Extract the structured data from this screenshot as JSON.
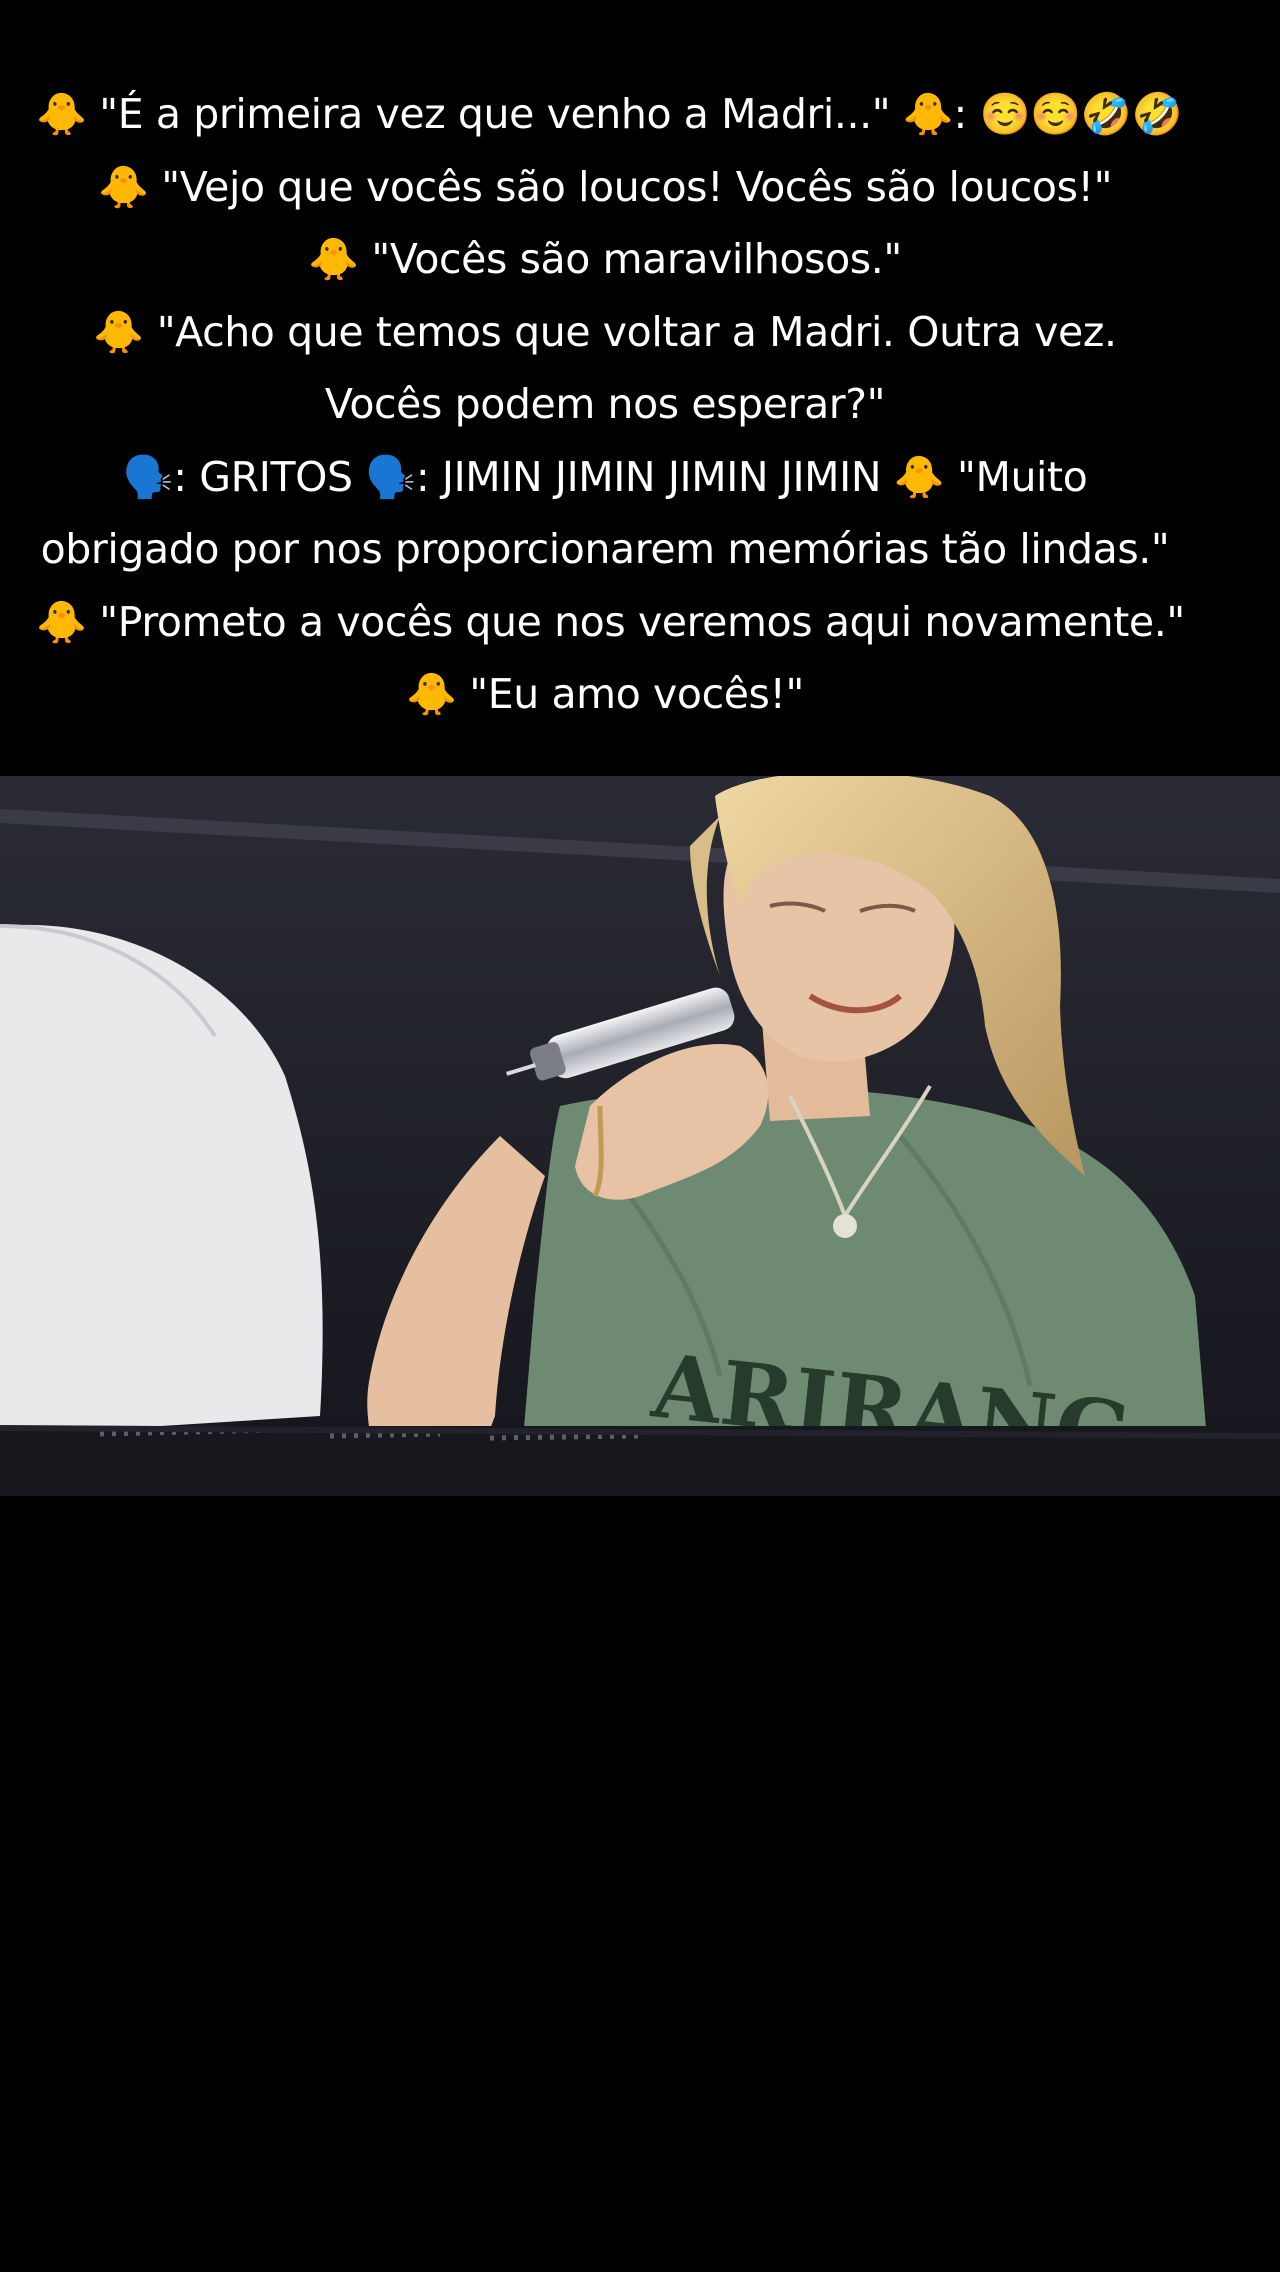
{
  "caption": {
    "lines": [
      "🐥 \"É a primeira vez que venho a Madri...\" 🐥: ☺️☺️🤣🤣",
      "🐥 \"Vejo que vocês são loucos! Vocês são loucos!\"",
      "🐥 \"Vocês são maravilhosos.\"",
      "🐥 \"Acho que temos que voltar a Madri. Outra vez. Vocês podem nos esperar?\"",
      "🗣️: GRITOS 🗣️: JIMIN JIMIN JIMIN JIMIN 🐥 \"Muito obrigado por nos proporcionarem memórias tão lindas.\"",
      "🐥 \"Prometo a vocês que nos veremos aqui novamente.\"",
      "🐥 \"Eu amo vocês!\""
    ]
  },
  "video": {
    "shirt_text": "ARIRANG",
    "colors": {
      "background": "#000000",
      "stage": "#1c1d25",
      "shirt": "#6f8a72",
      "hair": "#dcbf8a",
      "skin": "#e8c4a6"
    }
  }
}
